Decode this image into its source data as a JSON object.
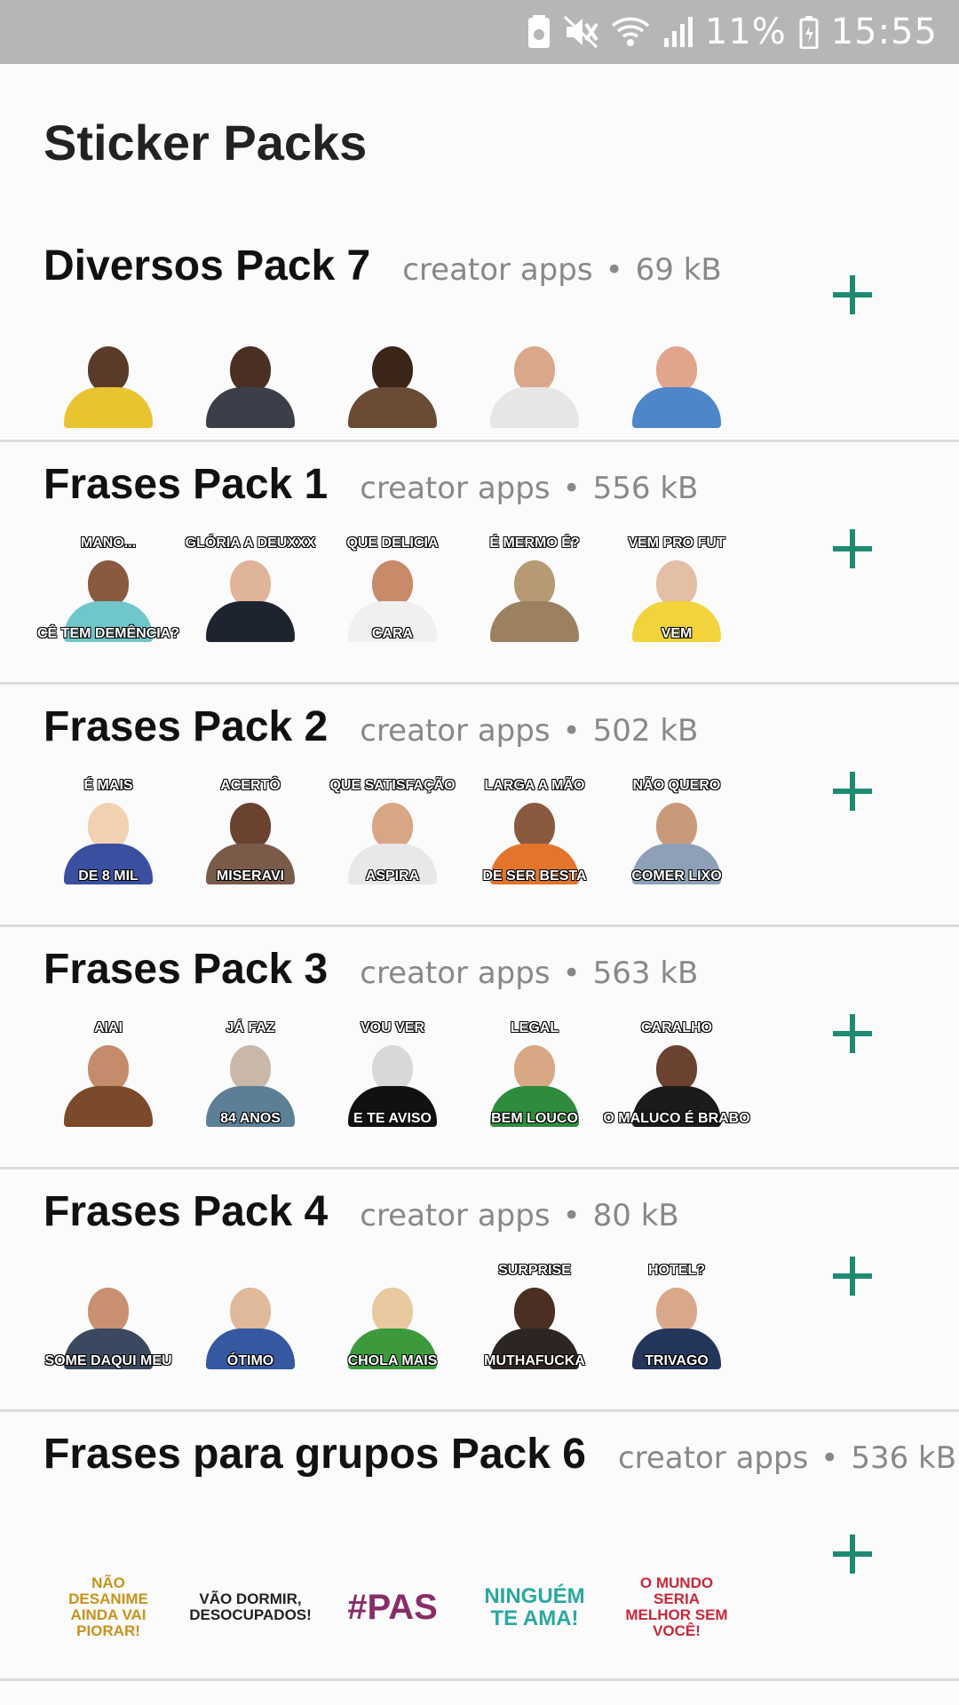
{
  "status_bar": {
    "battery": "11%",
    "time": "15:55"
  },
  "page": {
    "title": "Sticker Packs"
  },
  "packs": [
    {
      "name": "Diversos Pack 7",
      "creator": "creator apps",
      "size": "69 kB",
      "stickers": [
        {
          "top": "",
          "bottom": "",
          "skin": "#5a3a28",
          "shirt": "#e8c530"
        },
        {
          "top": "",
          "bottom": "",
          "skin": "#4a2f22",
          "shirt": "#3b3f49"
        },
        {
          "top": "",
          "bottom": "",
          "skin": "#3b2418",
          "shirt": "#6b4b35"
        },
        {
          "top": "",
          "bottom": "",
          "skin": "#d9a88a",
          "shirt": "#e6e6e6"
        },
        {
          "top": "",
          "bottom": "",
          "skin": "#e0a58a",
          "shirt": "#4f86c9"
        }
      ]
    },
    {
      "name": "Frases Pack 1",
      "creator": "creator apps",
      "size": "556 kB",
      "stickers": [
        {
          "top": "MANO...",
          "bottom": "CÊ TEM DEMÊNCIA?",
          "skin": "#8a5a3e",
          "shirt": "#6fc7c9"
        },
        {
          "top": "GLÓRIA A DEUXXX",
          "bottom": "",
          "skin": "#e0b499",
          "shirt": "#1d2430"
        },
        {
          "top": "QUE DELICIA",
          "bottom": "CARA",
          "skin": "#c88a68",
          "shirt": "#f0f0f0"
        },
        {
          "top": "É MERMO É?",
          "bottom": "",
          "skin": "#b69a74",
          "shirt": "#9c8160"
        },
        {
          "top": "VEM PRO FUT",
          "bottom": "VEM",
          "skin": "#e2bfa5",
          "shirt": "#f2d33c"
        }
      ]
    },
    {
      "name": "Frases Pack 2",
      "creator": "creator apps",
      "size": "502 kB",
      "stickers": [
        {
          "top": "É MAIS",
          "bottom": "DE 8 MIL",
          "skin": "#f2d1b2",
          "shirt": "#3a4fa0"
        },
        {
          "top": "ACERTÔ",
          "bottom": "MISERAVI",
          "skin": "#6b4230",
          "shirt": "#7a5a48"
        },
        {
          "top": "QUE SATISFAÇÃO",
          "bottom": "ASPIRA",
          "skin": "#d8a585",
          "shirt": "#e8e8e8"
        },
        {
          "top": "LARGA A MÃO",
          "bottom": "DE SER BESTA",
          "skin": "#8a5a3e",
          "shirt": "#e2742c"
        },
        {
          "top": "NÃO QUERO",
          "bottom": "COMER LIXO",
          "skin": "#c99a7a",
          "shirt": "#8ea0b8"
        }
      ]
    },
    {
      "name": "Frases Pack 3",
      "creator": "creator apps",
      "size": "563 kB",
      "stickers": [
        {
          "top": "AIAI",
          "bottom": "",
          "skin": "#c48c6a",
          "shirt": "#7b4a2a"
        },
        {
          "top": "JÁ FAZ",
          "bottom": "84 ANOS",
          "skin": "#c9b8a8",
          "shirt": "#5c7f96"
        },
        {
          "top": "VOU VER",
          "bottom": "E TE AVISO",
          "skin": "#d8d8d8",
          "shirt": "#111111"
        },
        {
          "top": "LEGAL",
          "bottom": "BEM LOUCO",
          "skin": "#d8a885",
          "shirt": "#2f8c3c"
        },
        {
          "top": "CARALHO",
          "bottom": "O MALUCO É BRABO",
          "skin": "#6b4230",
          "shirt": "#1b1b1b"
        }
      ]
    },
    {
      "name": "Frases Pack 4",
      "creator": "creator apps",
      "size": "80 kB",
      "stickers": [
        {
          "top": "",
          "bottom": "SOME DAQUI MEU",
          "skin": "#c89070",
          "shirt": "#3b4960"
        },
        {
          "top": "",
          "bottom": "ÓTIMO",
          "skin": "#e0b89a",
          "shirt": "#3658a0"
        },
        {
          "top": "",
          "bottom": "CHOLA MAIS",
          "skin": "#e8c9a0",
          "shirt": "#3c9a3c"
        },
        {
          "top": "SURPRISE",
          "bottom": "MUTHAFUCKA",
          "skin": "#4a2f22",
          "shirt": "#2d2522"
        },
        {
          "top": "HOTEL?",
          "bottom": "TRIVAGO",
          "skin": "#d9a88a",
          "shirt": "#24365c"
        }
      ]
    },
    {
      "name": "Frases para grupos Pack 6",
      "creator": "creator apps",
      "size": "536 kB",
      "text_stickers": [
        {
          "text": "NÃO DESANIME AINDA VAI PIORAR!",
          "color": "#c8921a"
        },
        {
          "text": "VÃO DORMIR, DESOCUPADOS!",
          "color": "#222222"
        },
        {
          "text": "#PAS",
          "color": "#8a2c6a"
        },
        {
          "text": "NINGUÉM TE AMA!",
          "color": "#2aa8a0"
        },
        {
          "text": "O MUNDO SERIA MELHOR SEM VOCÊ!",
          "color": "#c8283a"
        }
      ]
    }
  ],
  "colors": {
    "accent": "#1e8a72",
    "statusbar": "#b6b6b9"
  }
}
